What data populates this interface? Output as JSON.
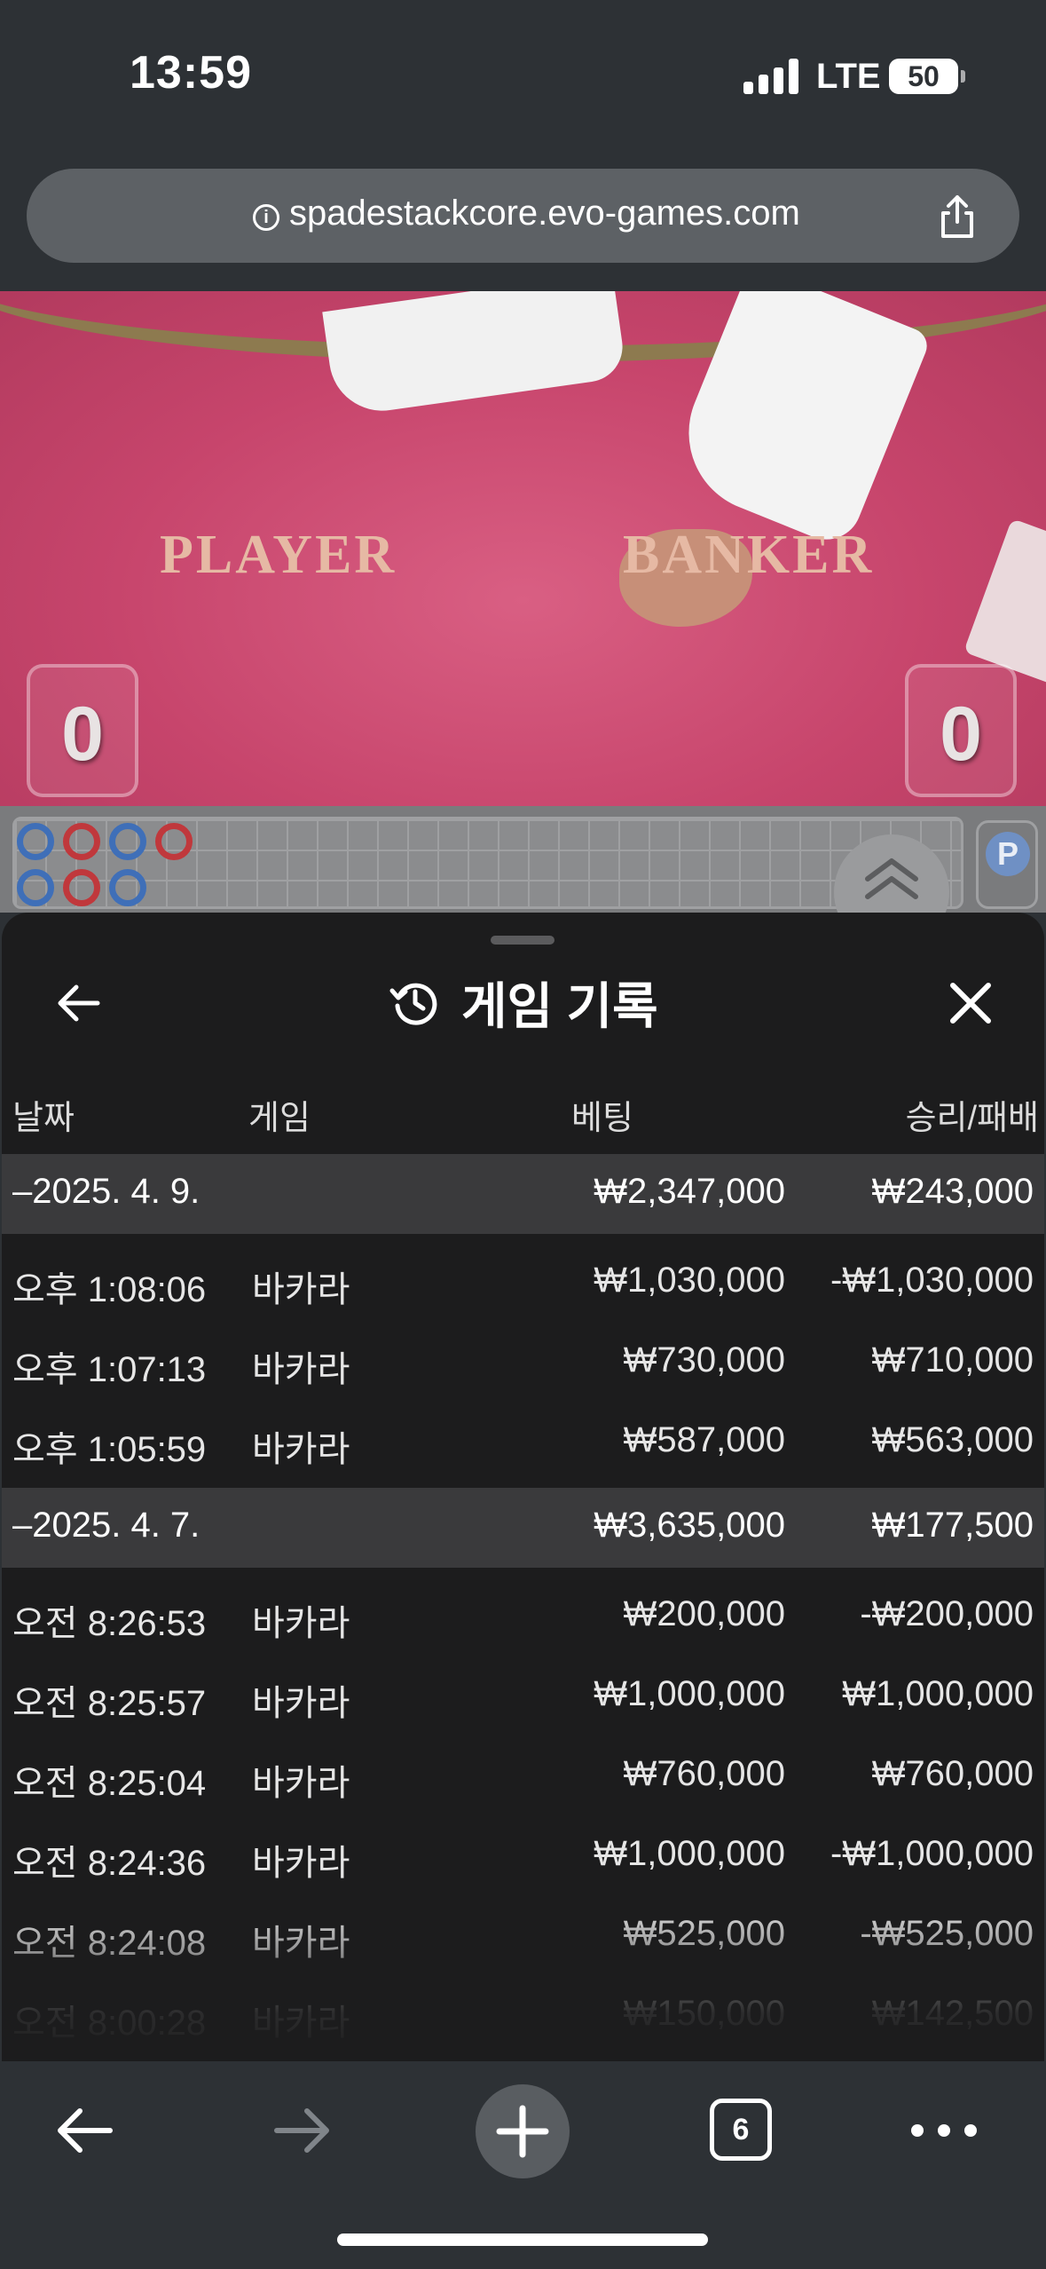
{
  "status_bar": {
    "time": "13:59",
    "network": "LTE",
    "battery": "50"
  },
  "browser": {
    "url": "spadestackcore.evo-games.com",
    "tab_count": "6"
  },
  "table": {
    "player_label": "PLAYER",
    "banker_label": "BANKER",
    "player_score": "0",
    "banker_score": "0"
  },
  "roadmap": {
    "chip_label": "P",
    "beads": [
      {
        "col": 0,
        "row": 0,
        "color": "#3f6fb8"
      },
      {
        "col": 1,
        "row": 0,
        "color": "#c0383c"
      },
      {
        "col": 2,
        "row": 0,
        "color": "#3f6fb8"
      },
      {
        "col": 3,
        "row": 0,
        "color": "#c0383c"
      },
      {
        "col": 0,
        "row": 1,
        "color": "#3f6fb8"
      },
      {
        "col": 1,
        "row": 1,
        "color": "#c0383c"
      },
      {
        "col": 2,
        "row": 1,
        "color": "#3f6fb8"
      }
    ]
  },
  "history": {
    "title": "게임 기록",
    "columns": {
      "date": "날짜",
      "game": "게임",
      "bet": "베팅",
      "result": "승리/패배"
    },
    "days": [
      {
        "date": "–2025. 4. 9.",
        "bet": "₩2,347,000",
        "result": "₩243,000",
        "rows": [
          {
            "time": "오후 1:08:06",
            "game": "바카라",
            "bet": "₩1,030,000",
            "result": "-₩1,030,000"
          },
          {
            "time": "오후 1:07:13",
            "game": "바카라",
            "bet": "₩730,000",
            "result": "₩710,000"
          },
          {
            "time": "오후 1:05:59",
            "game": "바카라",
            "bet": "₩587,000",
            "result": "₩563,000"
          }
        ]
      },
      {
        "date": "–2025. 4. 7.",
        "bet": "₩3,635,000",
        "result": "₩177,500",
        "rows": [
          {
            "time": "오전 8:26:53",
            "game": "바카라",
            "bet": "₩200,000",
            "result": "-₩200,000"
          },
          {
            "time": "오전 8:25:57",
            "game": "바카라",
            "bet": "₩1,000,000",
            "result": "₩1,000,000"
          },
          {
            "time": "오전 8:25:04",
            "game": "바카라",
            "bet": "₩760,000",
            "result": "₩760,000"
          },
          {
            "time": "오전 8:24:36",
            "game": "바카라",
            "bet": "₩1,000,000",
            "result": "-₩1,000,000"
          },
          {
            "time": "오전 8:24:08",
            "game": "바카라",
            "bet": "₩525,000",
            "result": "-₩525,000"
          },
          {
            "time": "오전 8:00:28",
            "game": "바카라",
            "bet": "₩150,000",
            "result": "₩142,500"
          }
        ]
      }
    ]
  },
  "icons": {
    "back": "arrow-left-icon",
    "close": "close-icon",
    "history": "history-clock-icon",
    "share": "share-icon",
    "info": "info-icon",
    "new_tab": "plus-icon",
    "more": "ellipsis-icon",
    "roadmap_toggle": "double-chevron-up-icon"
  }
}
